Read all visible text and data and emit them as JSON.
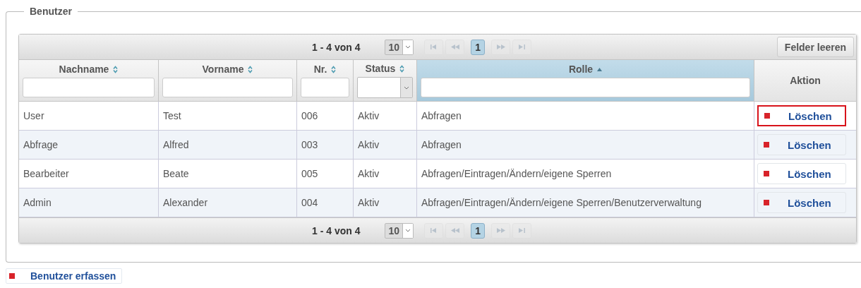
{
  "panel": {
    "legend": "Benutzer"
  },
  "paginator_top": {
    "range": "1 - 4 von 4",
    "page_size": "10",
    "pages": [
      {
        "label": "1",
        "selected": true
      }
    ],
    "nav_disabled": true
  },
  "clear_button": "Felder leeren",
  "columns": [
    {
      "label": "Nachname",
      "sortable": true,
      "sorted": false,
      "kind": "text"
    },
    {
      "label": "Vorname",
      "sortable": true,
      "sorted": false,
      "kind": "text"
    },
    {
      "label": "Nr.",
      "sortable": true,
      "sorted": false,
      "kind": "text"
    },
    {
      "label": "Status",
      "sortable": true,
      "sorted": false,
      "kind": "select"
    },
    {
      "label": "Rolle",
      "sortable": true,
      "sorted": true,
      "kind": "text"
    },
    {
      "label": "Aktion",
      "sortable": false,
      "sorted": false,
      "kind": "plain"
    }
  ],
  "rows": [
    {
      "cells": [
        "User",
        "Test",
        "006",
        "Aktiv",
        "Abfragen"
      ],
      "action": "Löschen",
      "focused": true
    },
    {
      "cells": [
        "Abfrage",
        "Alfred",
        "003",
        "Aktiv",
        "Abfragen"
      ],
      "action": "Löschen",
      "focused": false
    },
    {
      "cells": [
        "Bearbeiter",
        "Beate",
        "005",
        "Aktiv",
        "Abfragen/Eintragen/Ändern/eigene Sperren"
      ],
      "action": "Löschen",
      "focused": false
    },
    {
      "cells": [
        "Admin",
        "Alexander",
        "004",
        "Aktiv",
        "Abfragen/Eintragen/Ändern/eigene Sperren/Benutzerverwaltung"
      ],
      "action": "Löschen",
      "focused": false
    }
  ],
  "paginator_bottom": {
    "range": "1 - 4 von 4",
    "page_size": "10",
    "pages": [
      {
        "label": "1",
        "selected": true
      }
    ],
    "nav_disabled": true
  },
  "create_button": "Benutzer erfassen"
}
